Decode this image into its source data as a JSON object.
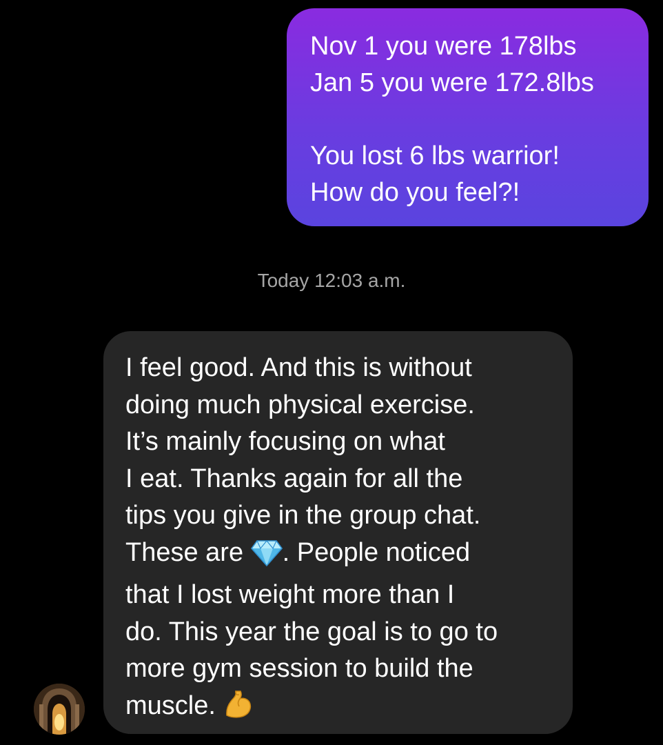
{
  "conversation": {
    "outgoing_message": {
      "line1": "Nov 1 you were 178lbs",
      "line2": "Jan 5 you were 172.8lbs",
      "line3": "You lost 6 lbs warrior!",
      "line4": "How do you feel?!"
    },
    "timestamp": "Today 12:03 a.m.",
    "incoming_message": {
      "line1": "I feel good. And this is without",
      "line2": "doing much physical exercise.",
      "line3": "It’s mainly focusing on what",
      "line4": "I eat. Thanks again for all the",
      "line5": "tips you give in the group chat.",
      "line6_before_emoji": "These are",
      "line6_after_emoji": ". People noticed",
      "line7": "that I lost weight more than I",
      "line8": "do. This year the goal is to go to",
      "line9": "more gym session to build the",
      "line10": "muscle.",
      "emojis": [
        "gem-emoji",
        "flexed-biceps-emoji"
      ]
    },
    "sender_avatar_icon": "archway-avatar"
  },
  "colors": {
    "background": "#000000",
    "outgoing_bubble_top": "#8a2be0",
    "outgoing_bubble_bottom": "#5a44df",
    "incoming_bubble": "#262626",
    "timestamp_text": "#a6a6a6"
  }
}
